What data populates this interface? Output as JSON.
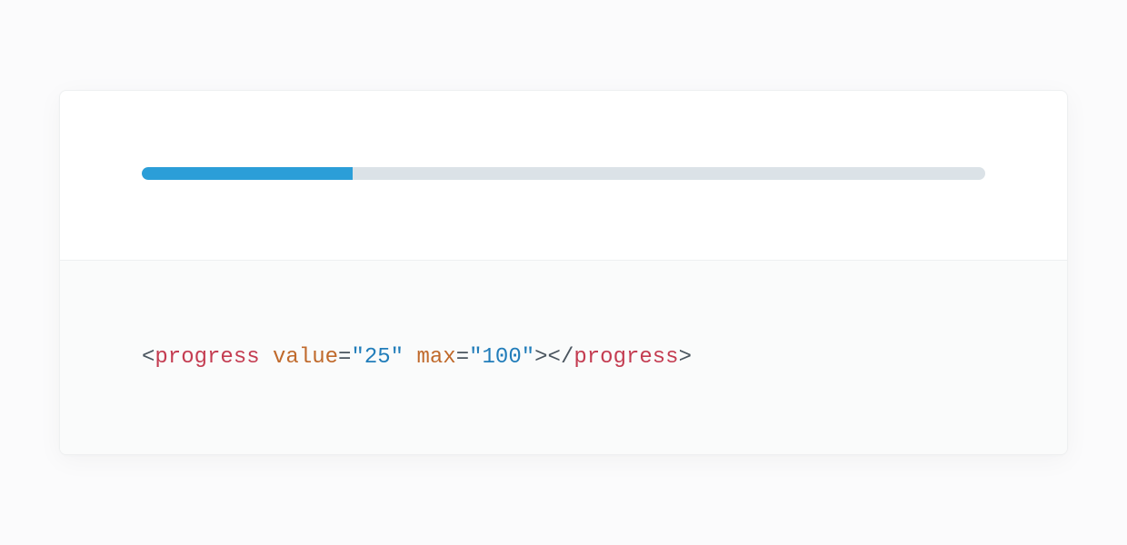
{
  "progress": {
    "value": 25,
    "max": 100
  },
  "code": {
    "open_angle": "<",
    "tag_open": "progress",
    "space1": " ",
    "attr1_name": "value",
    "eq": "=",
    "quote": "\"",
    "attr1_value": "25",
    "space2": " ",
    "attr2_name": "max",
    "attr2_value": "100",
    "close_angle": ">",
    "open_angle_slash": "</",
    "tag_close": "progress"
  }
}
